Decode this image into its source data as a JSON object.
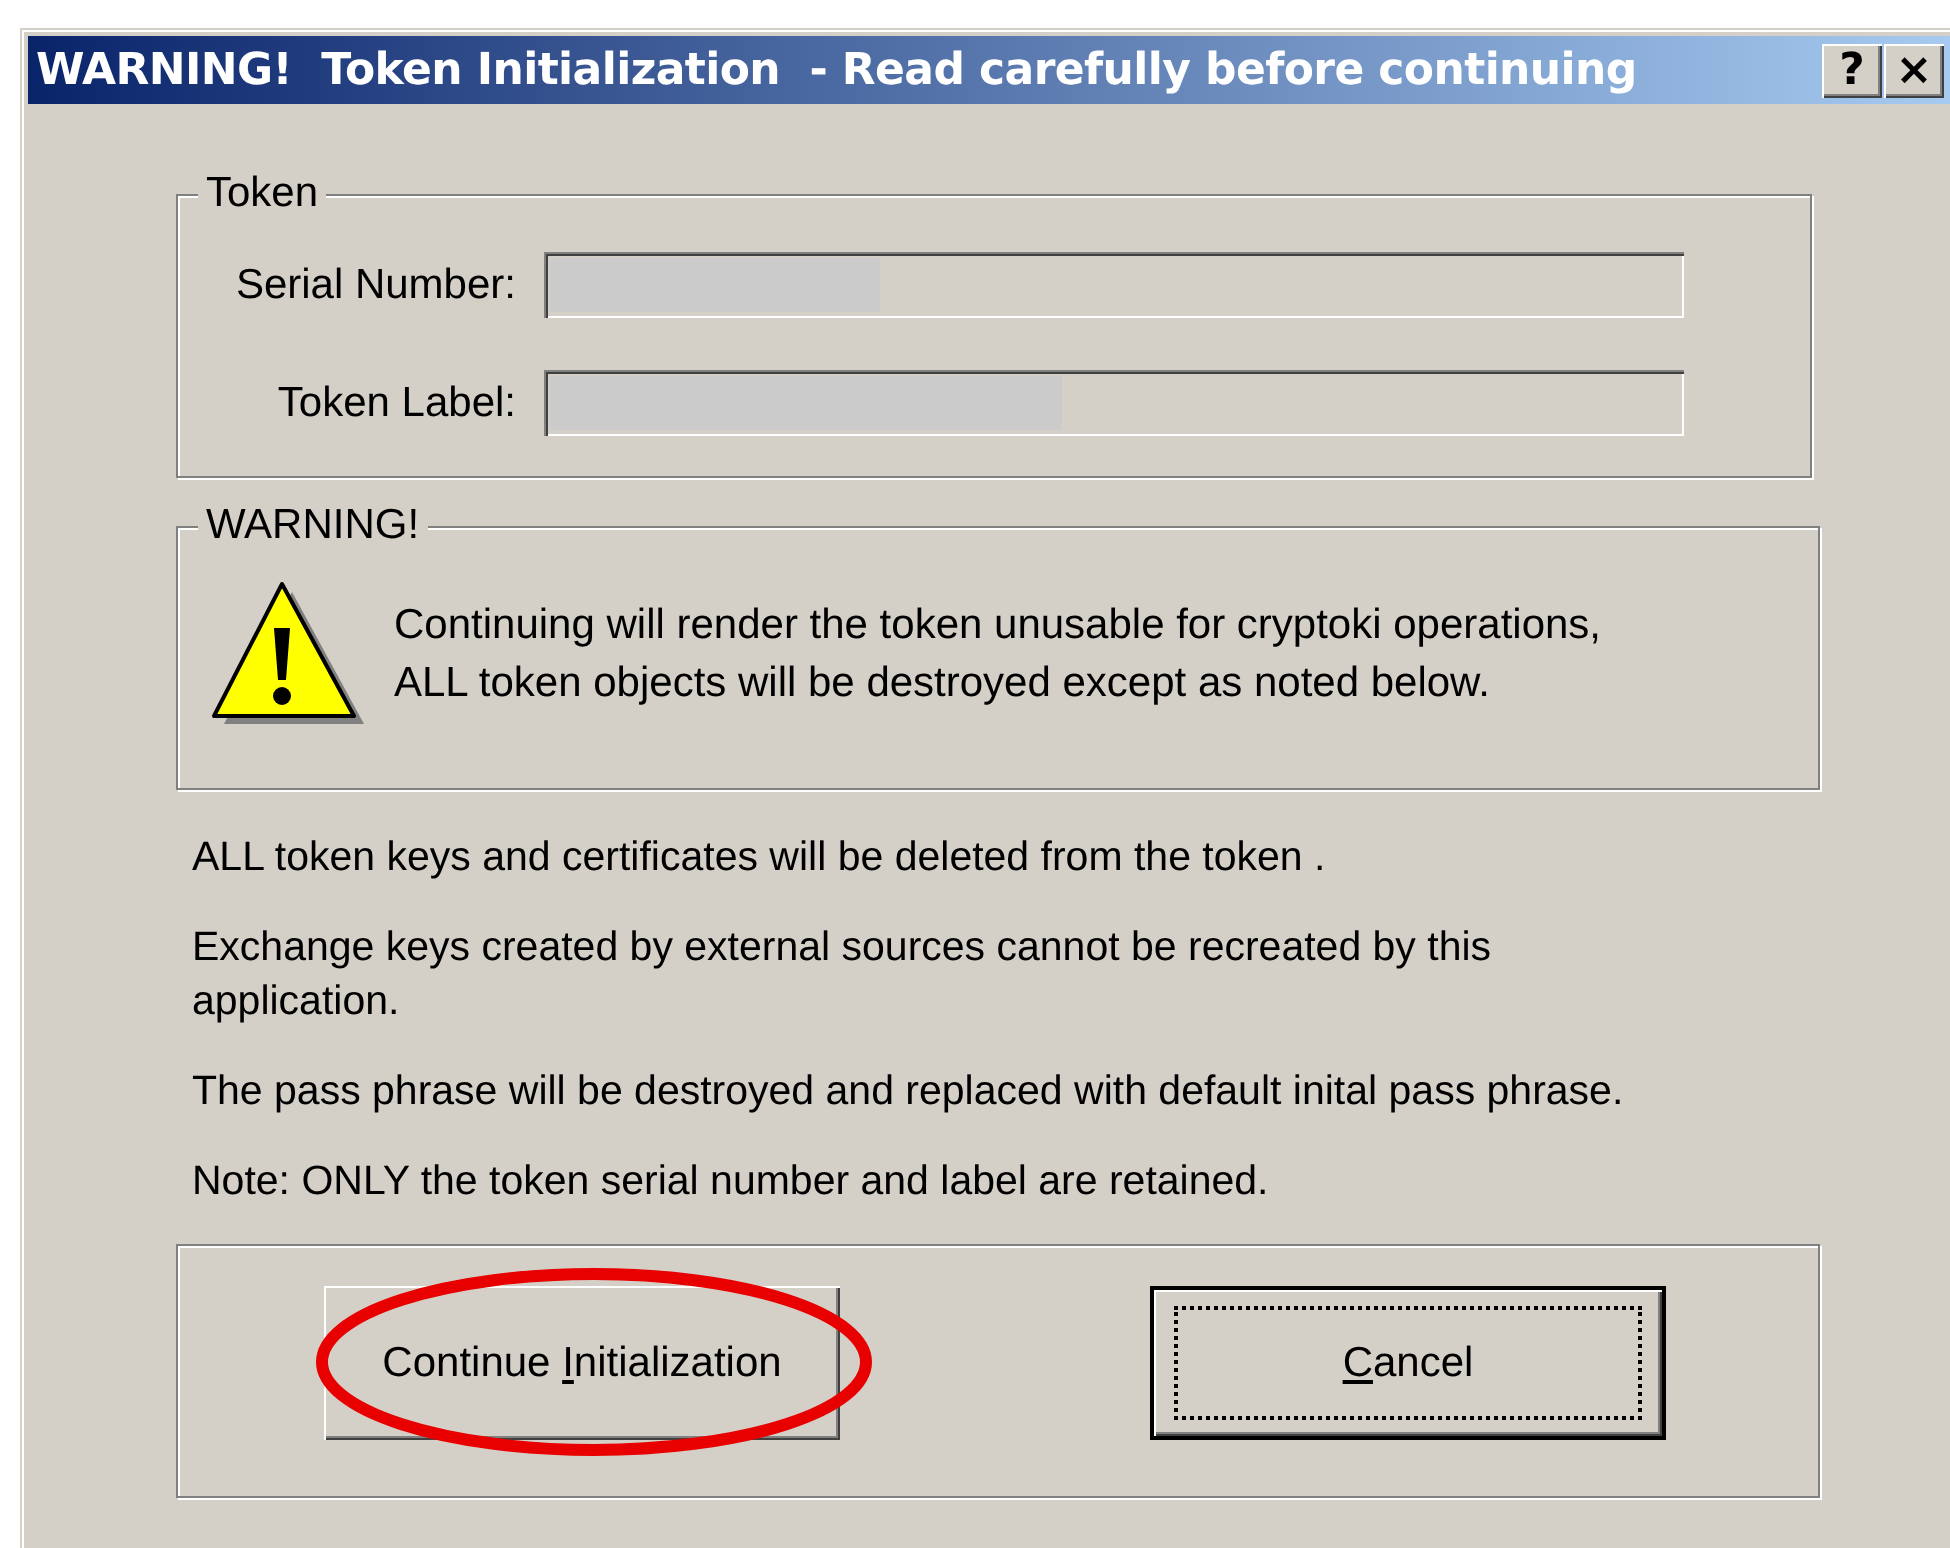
{
  "window": {
    "title": "WARNING!  Token Initialization  - Read carefully before continuing",
    "title_buttons": [
      {
        "kind": "help",
        "label": "?"
      },
      {
        "kind": "close",
        "label": "×"
      }
    ]
  },
  "token_group": {
    "legend": "Token",
    "fields": [
      {
        "label": "Serial Number:",
        "redacted": true,
        "disabled": true
      },
      {
        "label": "Token Label:",
        "redacted": true,
        "disabled": true
      }
    ]
  },
  "warning_group": {
    "legend": "WARNING!",
    "lines": [
      "Continuing will render the token unusable for cryptoki operations,",
      "ALL token objects will be destroyed except as noted below."
    ]
  },
  "notes": [
    "ALL token keys and certificates will be deleted from the token .",
    "Exchange keys created by external sources cannot be recreated by this application.",
    "The pass phrase will be destroyed and replaced with default inital pass phrase.",
    "Note: ONLY the token serial number and label are retained."
  ],
  "buttons": [
    {
      "before": "Continue ",
      "key": "I",
      "after": "nitialization",
      "default": false,
      "highlighted": true
    },
    {
      "key": "C",
      "after": "ancel",
      "default": true,
      "highlighted": false
    }
  ]
}
